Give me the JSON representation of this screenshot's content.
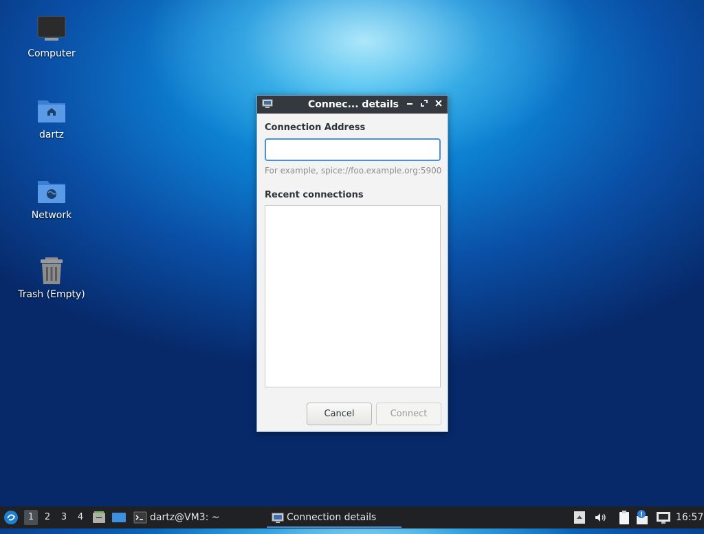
{
  "desktop": {
    "icons": [
      {
        "label": "Computer",
        "icon": "computer-icon"
      },
      {
        "label": "dartz",
        "icon": "home-folder-icon"
      },
      {
        "label": "Network",
        "icon": "network-folder-icon"
      },
      {
        "label": "Trash (Empty)",
        "icon": "trash-icon"
      }
    ]
  },
  "dialog": {
    "title": "Connec... details",
    "address_label": "Connection Address",
    "address_value": "",
    "address_hint": "For example, spice://foo.example.org:5900",
    "recent_label": "Recent connections",
    "recent_items": [],
    "cancel_label": "Cancel",
    "connect_label": "Connect"
  },
  "taskbar": {
    "workspaces": [
      "1",
      "2",
      "3",
      "4"
    ],
    "active_workspace": "1",
    "terminal_task": "dartz@VM3: ~",
    "active_task": "Connection details",
    "clock": "16:57"
  },
  "colors": {
    "accent": "#4a90d9",
    "titlebar": "#33393f",
    "taskbar": "#1f2125"
  }
}
